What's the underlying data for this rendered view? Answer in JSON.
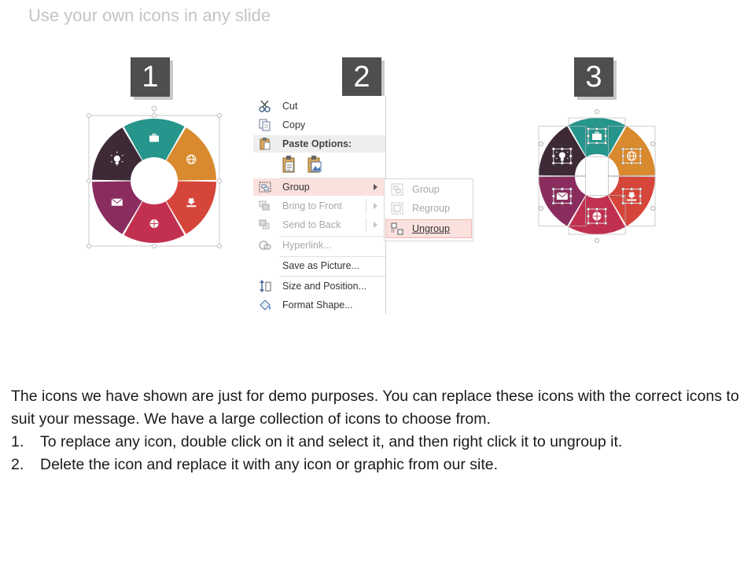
{
  "slide": {
    "title": "Use your own icons in any slide"
  },
  "steps": [
    "1",
    "2",
    "3"
  ],
  "colors": {
    "teal": "#26958b",
    "orange": "#d98a2e",
    "red": "#d6453a",
    "crimson": "#c23050",
    "plum": "#8a2d5e",
    "dark": "#3d2a36",
    "badge": "#4e4e4e",
    "highlight": "#fbe1de"
  },
  "ring_segments": [
    {
      "name": "teal",
      "icon": "briefcase-icon"
    },
    {
      "name": "orange",
      "icon": "globe-icon"
    },
    {
      "name": "red",
      "icon": "download-icon"
    },
    {
      "name": "crimson",
      "icon": "basketball-icon"
    },
    {
      "name": "plum",
      "icon": "mail-icon"
    },
    {
      "name": "dark",
      "icon": "lightbulb-icon"
    }
  ],
  "context_menu": {
    "cut": "Cut",
    "copy": "Copy",
    "paste_options": "Paste Options:",
    "group": "Group",
    "bring_to_front": "Bring to Front",
    "send_to_back": "Send to Back",
    "hyperlink": "Hyperlink...",
    "save_as_picture": "Save as Picture...",
    "size_and_position": "Size and Position...",
    "format_shape": "Format Shape..."
  },
  "submenu": {
    "group": "Group",
    "regroup": "Regroup",
    "ungroup": "Ungroup"
  },
  "body": {
    "intro": "The icons we have shown are just for demo purposes. You can replace these icons with the correct icons to suit your message. We have a large collection of icons to choose from.",
    "steps": [
      {
        "num": "1.",
        "text": "To replace any icon, double click on it and select it, and then right click it to ungroup it."
      },
      {
        "num": "2.",
        "text": "Delete the icon and replace it with any icon or graphic from our site."
      }
    ]
  }
}
